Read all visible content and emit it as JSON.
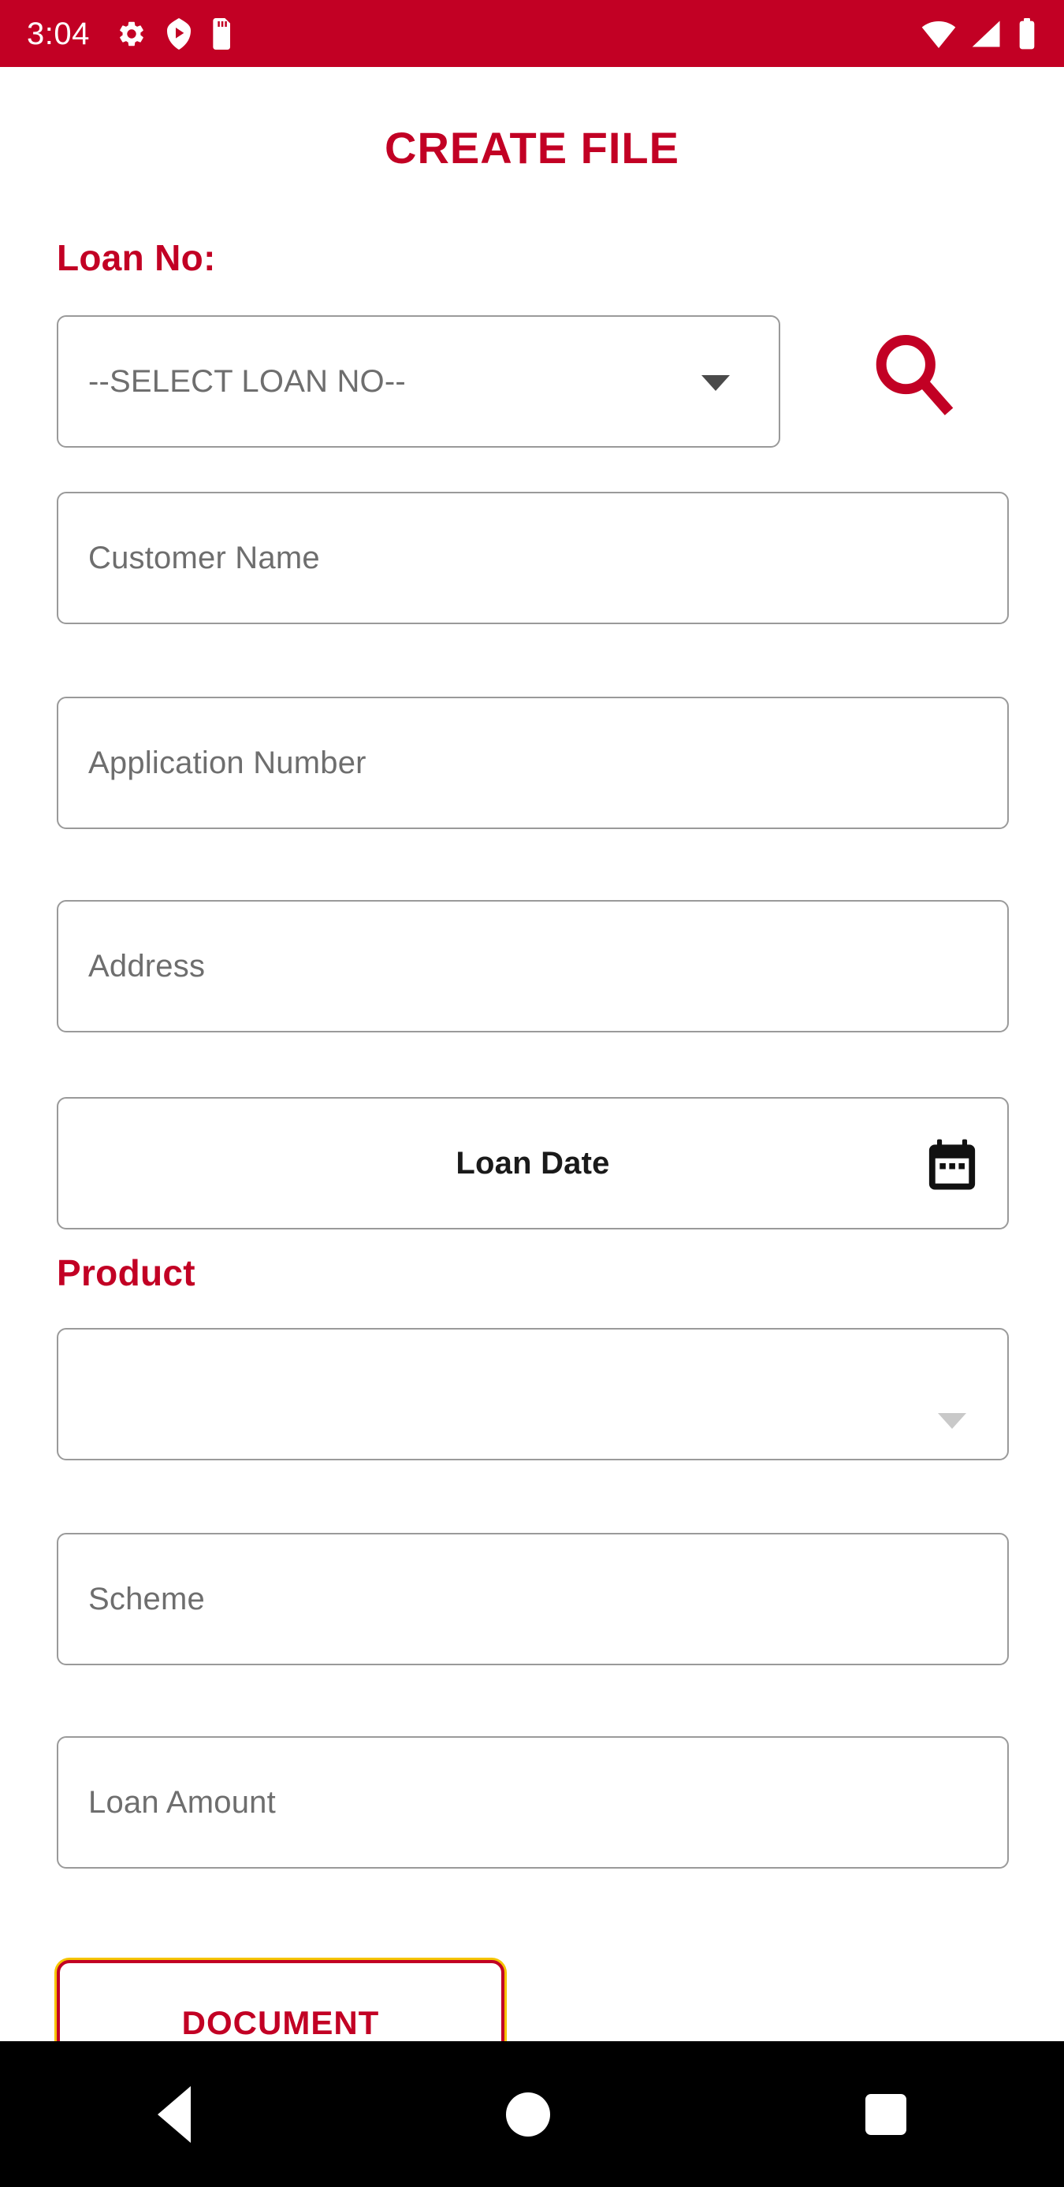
{
  "status_bar": {
    "time": "3:04",
    "background_color": "#c20024",
    "left_icons": [
      "gear-icon",
      "play-badge-icon",
      "sd-card-icon"
    ],
    "right_icons": [
      "wifi-icon",
      "signal-icon",
      "battery-icon"
    ]
  },
  "header": {
    "title": "CREATE FILE",
    "title_color": "#c20024"
  },
  "form": {
    "loan_no_label": "Loan No:",
    "loan_no_select": {
      "value": "--SELECT LOAN NO--",
      "icon": "chevron-down-icon"
    },
    "search_button": {
      "icon": "search-icon",
      "color": "#c20024"
    },
    "customer_name": {
      "placeholder": "Customer Name",
      "value": ""
    },
    "application_number": {
      "placeholder": "Application Number",
      "value": ""
    },
    "address": {
      "placeholder": "Address",
      "value": ""
    },
    "loan_date": {
      "label": "Loan Date",
      "value": "",
      "icon": "calendar-icon"
    },
    "product_label": "Product",
    "product_select": {
      "value": "",
      "icon": "chevron-down-icon"
    },
    "scheme": {
      "placeholder": "Scheme",
      "value": ""
    },
    "loan_amount": {
      "placeholder": "Loan Amount",
      "value": ""
    }
  },
  "actions": {
    "document_button": "DOCUMENT"
  },
  "nav_bar": {
    "back": "back-icon",
    "home": "home-icon",
    "recents": "recents-icon",
    "background_color": "#000000"
  },
  "colors": {
    "brand_red": "#c20024",
    "field_border": "#9a9a9a",
    "placeholder_text": "#6e6e6e",
    "button_glow": "#f5c400"
  }
}
